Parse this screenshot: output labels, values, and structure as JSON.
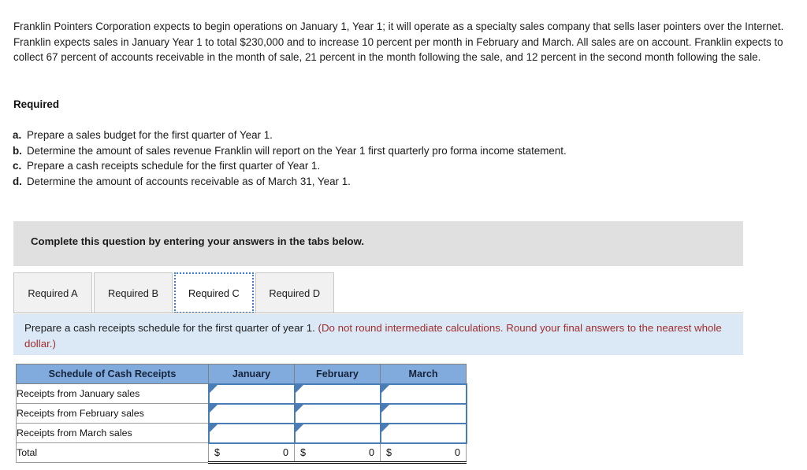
{
  "problem": {
    "paragraph": "Franklin Pointers Corporation expects to begin operations on January 1, Year 1; it will operate as a specialty sales company that sells laser pointers over the Internet. Franklin expects sales in January Year 1 to total $230,000 and to increase 10 percent per month in February and March. All sales are on account. Franklin expects to collect 67 percent of accounts receivable in the month of sale, 21 percent in the month following the sale, and 12 percent in the second month following the sale."
  },
  "required": {
    "heading": "Required",
    "items": [
      {
        "letter": "a.",
        "text": "Prepare a sales budget for the first quarter of Year 1."
      },
      {
        "letter": "b.",
        "text": "Determine the amount of sales revenue Franklin will report on the Year 1 first quarterly pro forma income statement."
      },
      {
        "letter": "c.",
        "text": "Prepare a cash receipts schedule for the first quarter of Year 1."
      },
      {
        "letter": "d.",
        "text": "Determine the amount of accounts receivable as of March 31, Year 1."
      }
    ]
  },
  "banner": {
    "text": "Complete this question by entering your answers in the tabs below."
  },
  "tabs": {
    "items": [
      {
        "label": "Required A",
        "active": false
      },
      {
        "label": "Required B",
        "active": false
      },
      {
        "label": "Required C",
        "active": true
      },
      {
        "label": "Required D",
        "active": false
      }
    ]
  },
  "instruction": {
    "main": "Prepare a cash receipts schedule for the first quarter of year 1.",
    "note": "(Do not round intermediate calculations. Round your final answers to the nearest whole dollar.)"
  },
  "table": {
    "columns": [
      "Schedule of Cash Receipts",
      "January",
      "February",
      "March"
    ],
    "rows": [
      {
        "label": "Receipts from January sales",
        "values": [
          "",
          "",
          ""
        ]
      },
      {
        "label": "Receipts from February sales",
        "values": [
          "",
          "",
          ""
        ]
      },
      {
        "label": "Receipts from March sales",
        "values": [
          "",
          "",
          ""
        ]
      }
    ],
    "total": {
      "label": "Total",
      "currency": "$",
      "values": [
        "0",
        "0",
        "0"
      ]
    }
  },
  "colors": {
    "header_blue": "#82abdd",
    "input_border": "#4a7cb5",
    "strip_blue": "#dbe9f6",
    "banner_grey": "#e0e0e0",
    "note_red": "#a02c2c"
  }
}
